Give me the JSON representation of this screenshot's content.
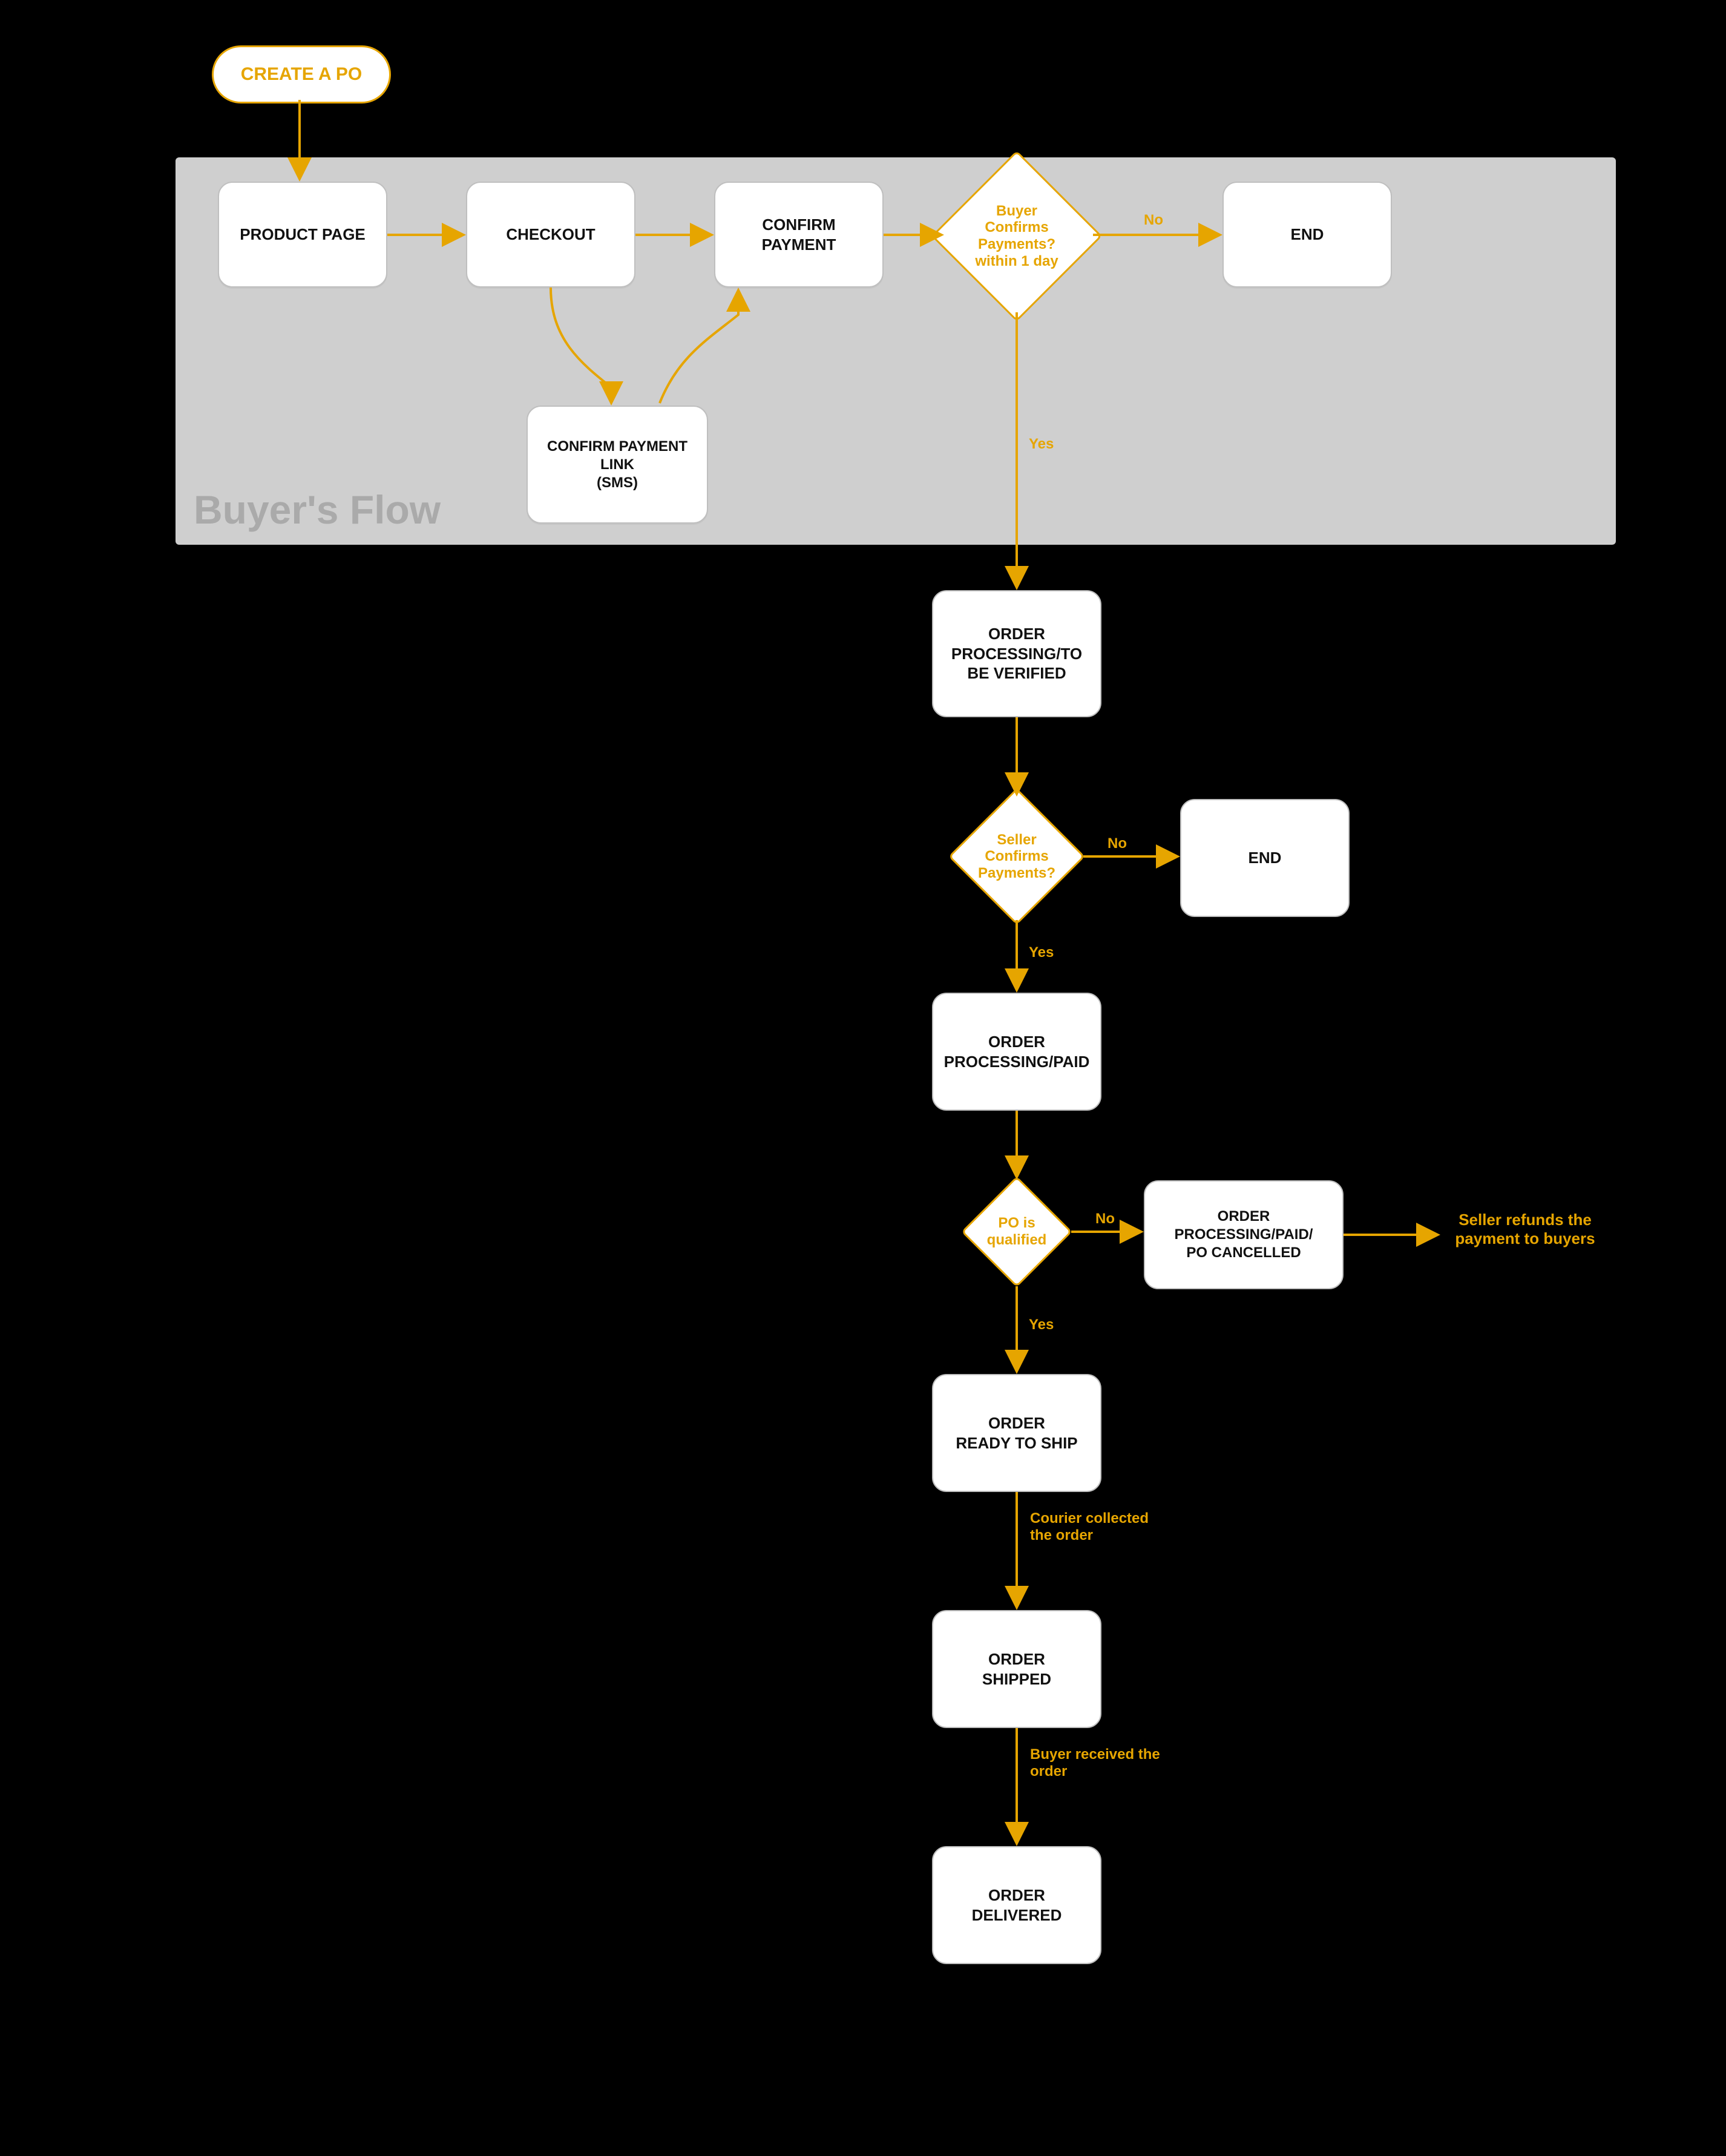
{
  "flowchart": {
    "panel_title": "Buyer's Flow",
    "start": {
      "label": "CREATE A PO"
    },
    "nodes": {
      "product_page": {
        "label": "PRODUCT PAGE"
      },
      "checkout": {
        "label": "CHECKOUT"
      },
      "confirm_payment": {
        "label": "CONFIRM PAYMENT"
      },
      "confirm_link": {
        "label": "CONFIRM PAYMENT LINK\n(SMS)"
      },
      "end_top": {
        "label": "END"
      },
      "order_verify": {
        "label": "ORDER PROCESSING/TO BE VERIFIED"
      },
      "end_seller": {
        "label": "END"
      },
      "order_paid": {
        "label": "ORDER PROCESSING/PAID"
      },
      "po_cancelled": {
        "label": "ORDER PROCESSING/PAID/\nPO CANCELLED"
      },
      "ready_ship": {
        "label": "ORDER\nREADY TO SHIP"
      },
      "shipped": {
        "label": "ORDER\nSHIPPED"
      },
      "delivered": {
        "label": "ORDER\nDELIVERED"
      }
    },
    "decisions": {
      "buyer_confirms": {
        "text": "Buyer Confirms Payments?\nwithin 1 day"
      },
      "seller_confirms": {
        "text": "Seller Confirms Payments?"
      },
      "po_qualified": {
        "text": "PO is qualified"
      }
    },
    "edge_labels": {
      "no": "No",
      "yes": "Yes",
      "courier": "Courier collected the order",
      "buyer_recv": "Buyer received the order"
    },
    "side_note": "Seller refunds the payment to buyers"
  }
}
